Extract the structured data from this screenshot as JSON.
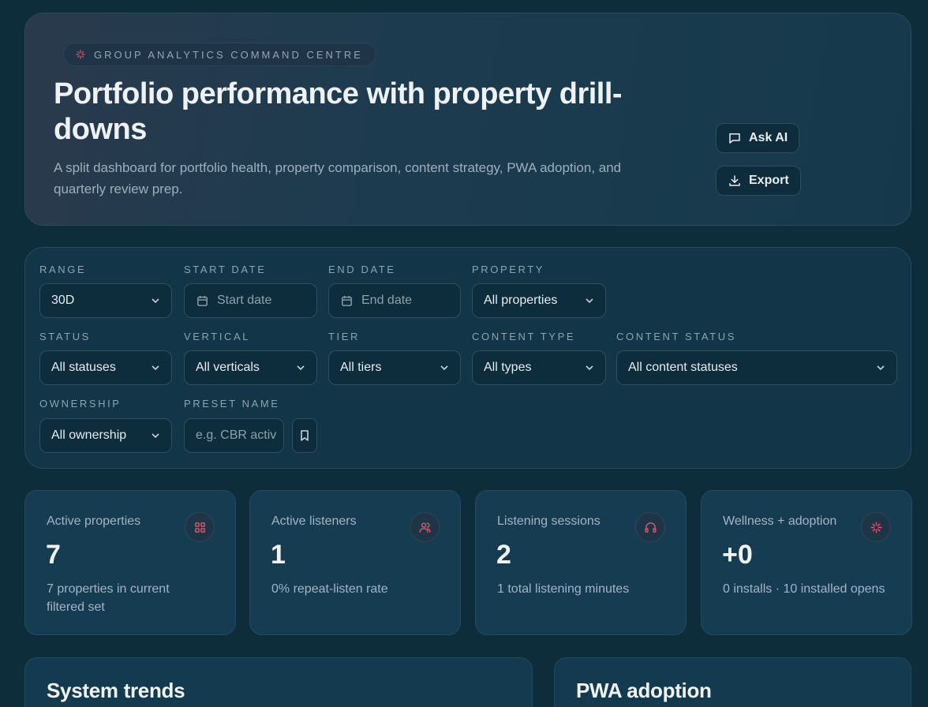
{
  "header": {
    "eyebrow": "GROUP ANALYTICS COMMAND CENTRE",
    "title": "Portfolio performance with property drill-downs",
    "subtitle": "A split dashboard for portfolio health, property comparison, content strategy, PWA adoption, and quarterly review prep.",
    "ask_ai_label": "Ask AI",
    "export_label": "Export"
  },
  "filters": {
    "range": {
      "label": "RANGE",
      "value": "30D"
    },
    "start_date": {
      "label": "START DATE",
      "placeholder": "Start date"
    },
    "end_date": {
      "label": "END DATE",
      "placeholder": "End date"
    },
    "property": {
      "label": "PROPERTY",
      "value": "All properties"
    },
    "status": {
      "label": "STATUS",
      "value": "All statuses"
    },
    "vertical": {
      "label": "VERTICAL",
      "value": "All verticals"
    },
    "tier": {
      "label": "TIER",
      "value": "All tiers"
    },
    "content_type": {
      "label": "CONTENT TYPE",
      "value": "All types"
    },
    "content_status": {
      "label": "CONTENT STATUS",
      "value": "All content statuses"
    },
    "ownership": {
      "label": "OWNERSHIP",
      "value": "All ownership"
    },
    "preset_name": {
      "label": "PRESET NAME",
      "placeholder": "e.g. CBR activ"
    }
  },
  "kpis": [
    {
      "label": "Active properties",
      "value": "7",
      "footnote": "7 properties in current filtered set",
      "icon": "grid-icon"
    },
    {
      "label": "Active listeners",
      "value": "1",
      "footnote": "0% repeat-listen rate",
      "icon": "users-icon"
    },
    {
      "label": "Listening sessions",
      "value": "2",
      "footnote": "1 total listening minutes",
      "icon": "headphones-icon"
    },
    {
      "label": "Wellness + adoption",
      "value": "+0",
      "footnote": "0 installs · 10 installed opens",
      "icon": "sparkle-icon"
    }
  ],
  "panels": {
    "system_trends": "System trends",
    "pwa_adoption": "PWA adoption"
  },
  "colors": {
    "accent": "#e0566a",
    "background": "#0e2d3b"
  }
}
